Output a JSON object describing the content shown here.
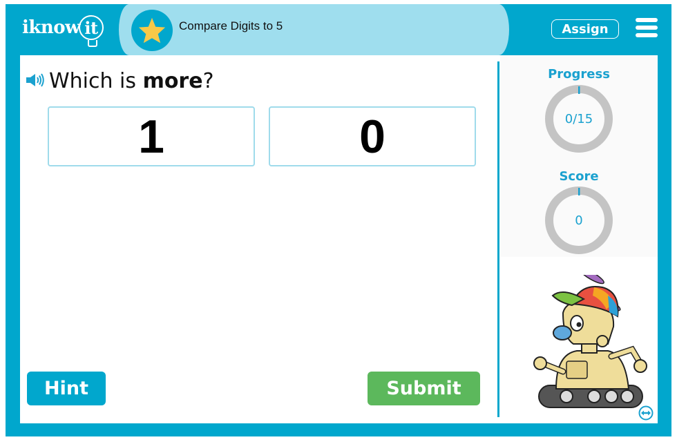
{
  "header": {
    "logo_text": "iknow",
    "logo_bulb_text": "it",
    "lesson_icon": "star-icon",
    "lesson_title": "Compare Digits to 5",
    "assign_label": "Assign",
    "menu_icon": "hamburger-menu-icon"
  },
  "question": {
    "speaker_icon": "speaker-icon",
    "prefix": "Which is ",
    "emphasis": "more",
    "suffix": "?"
  },
  "choices": [
    {
      "label": "1"
    },
    {
      "label": "0"
    }
  ],
  "buttons": {
    "hint_label": "Hint",
    "submit_label": "Submit"
  },
  "sidebar": {
    "progress": {
      "label": "Progress",
      "text": "0/15",
      "completed": 0,
      "total": 15
    },
    "score": {
      "label": "Score",
      "text": "0",
      "value": 0
    },
    "mascot": "robot-mascot",
    "expand_icon": "expand-arrows-icon"
  },
  "colors": {
    "brand": "#01a7cd",
    "header_pill": "#9fdeee",
    "star": "#f7c948",
    "submit": "#5cb85c",
    "ring_track": "#c4c4c4",
    "ring_accent": "#1aa1cf"
  }
}
